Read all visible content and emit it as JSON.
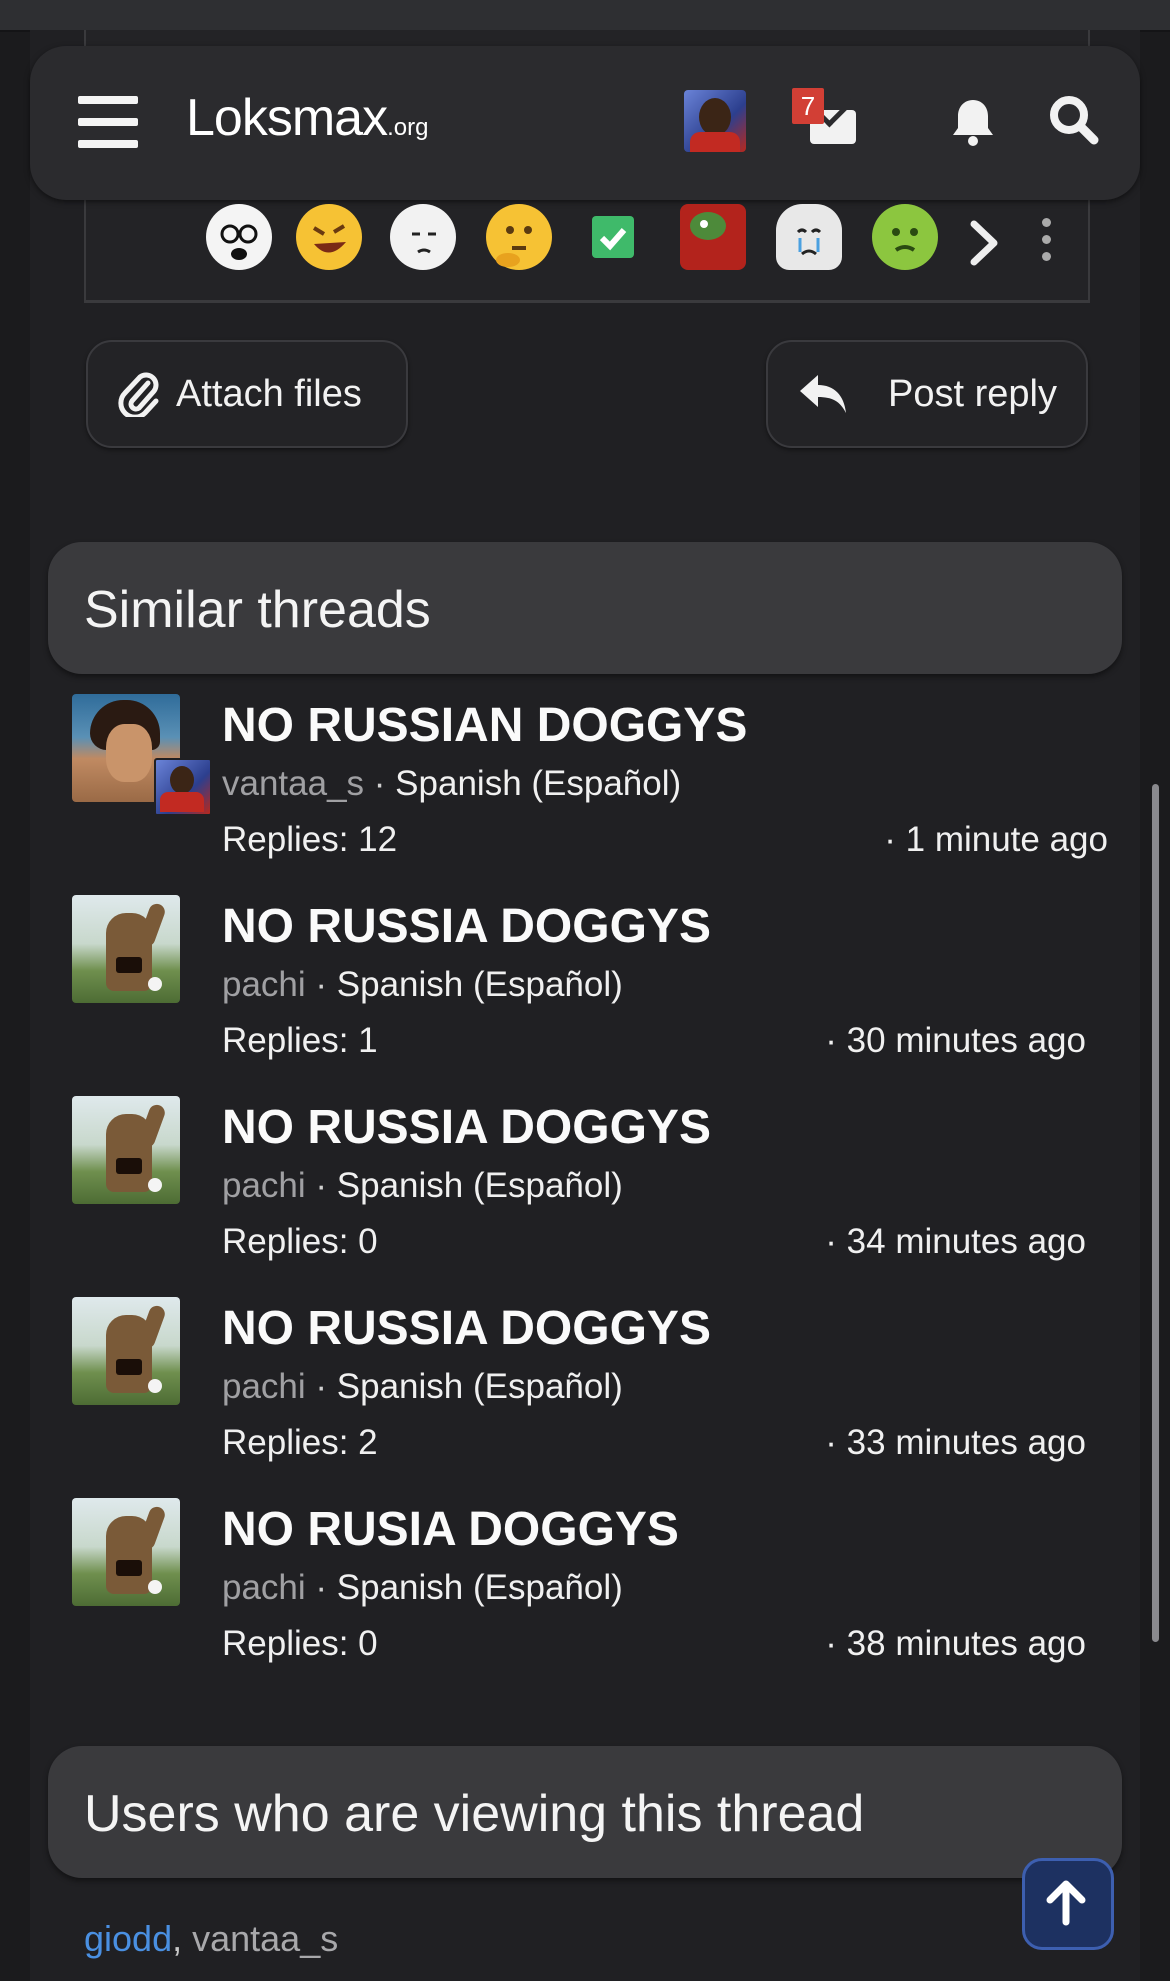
{
  "header": {
    "logo_main": "Lo​ksmax",
    "logo_suffix": ".org",
    "inbox_badge": "7"
  },
  "emoji_bar": {
    "items": [
      "soyjak-emoji",
      "rofl-emoji",
      "wojak-thinking-emoji",
      "thinking-face-emoji",
      "check-mark-emoji",
      "pepe-emoji",
      "crying-wojak-emoji",
      "nauseated-emoji"
    ]
  },
  "actions": {
    "attach_label": "Attach files",
    "post_label": "Post reply"
  },
  "similar": {
    "title": "Similar threads",
    "threads": [
      {
        "title": "NO RUSSIAN DOGGYS",
        "user": "vantaa_s",
        "forum": "Spanish (Español)",
        "replies": "Replies: 12",
        "time": "· 1 minute ago"
      },
      {
        "title": "NO RUSSIA DOGGYS",
        "user": "pachi",
        "forum": "Spanish (Español)",
        "replies": "Replies: 1",
        "time": "· 30 minutes ago"
      },
      {
        "title": "NO RUSSIA DOGGYS",
        "user": "pachi",
        "forum": "Spanish (Español)",
        "replies": "Replies: 0",
        "time": "· 34 minutes ago"
      },
      {
        "title": "NO RUSSIA DOGGYS",
        "user": "pachi",
        "forum": "Spanish (Español)",
        "replies": "Replies: 2",
        "time": "· 33 minutes ago"
      },
      {
        "title": "NO RUSIA DOGGYS",
        "user": "pachi",
        "forum": "Spanish (Español)",
        "replies": "Replies: 0",
        "time": "· 38 minutes ago"
      }
    ]
  },
  "viewers": {
    "title": "Users who are viewing this thread",
    "user1": "giodd",
    "separator": ", ",
    "user2": "vantaa_s"
  },
  "colors": {
    "background": "#1b1b1d",
    "panel": "#202023",
    "section_header": "#3a3a3d",
    "link": "#4a90e2",
    "badge": "#d23f35",
    "scroll_top_button": "#1d3161"
  }
}
